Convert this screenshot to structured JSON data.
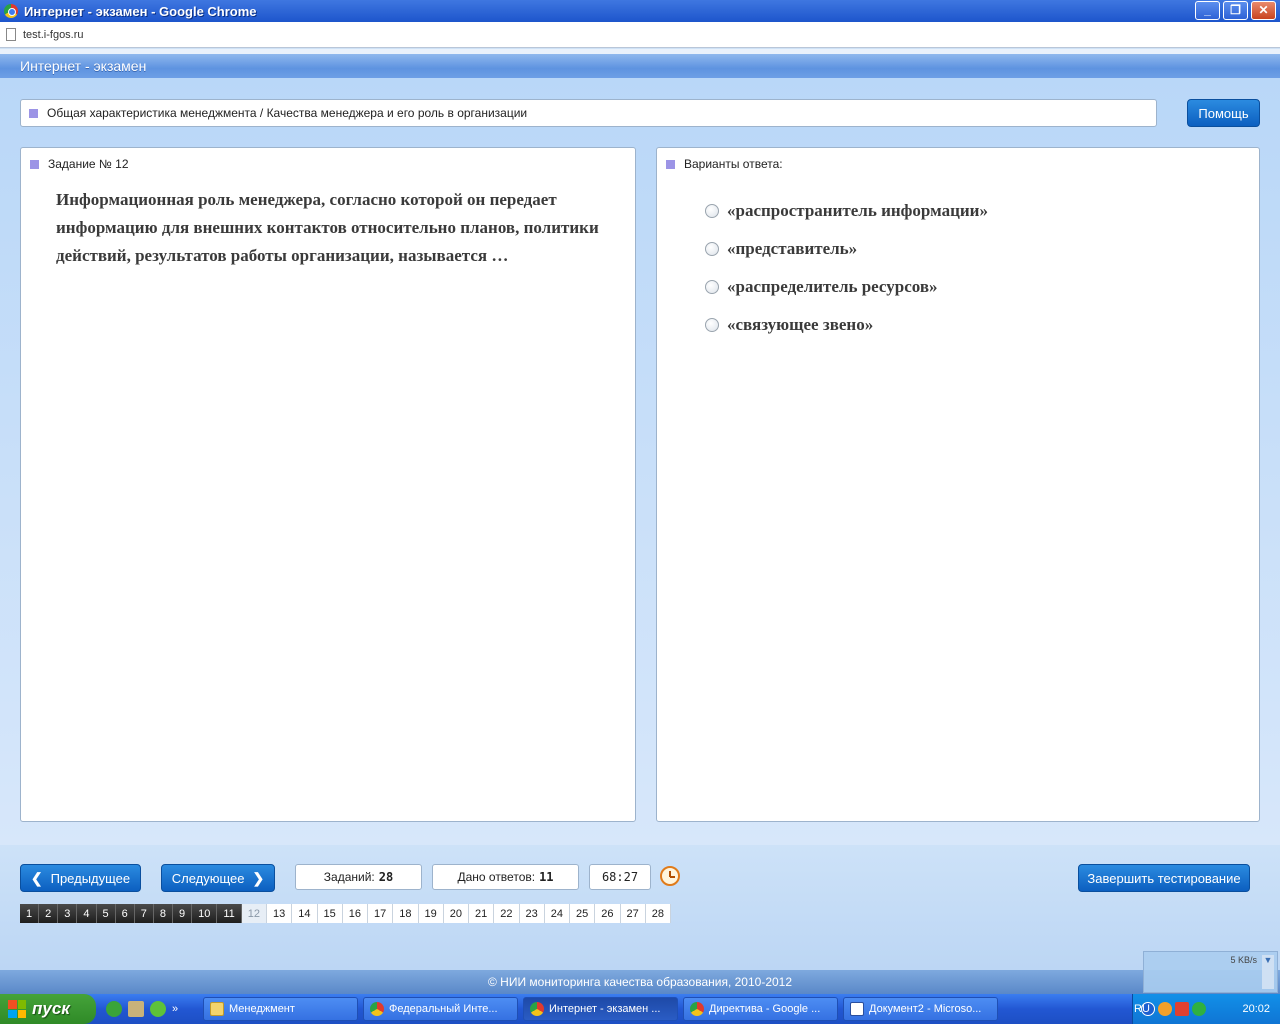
{
  "window": {
    "title": "Интернет - экзамен - Google Chrome",
    "url": "test.i-fgos.ru",
    "buttons": {
      "minimize": "_",
      "restore": "❐",
      "close": "✕"
    }
  },
  "app": {
    "title": "Интернет - экзамен",
    "breadcrumb": "Общая характеристика менеджмента / Качества менеджера и его роль в организации",
    "help_label": "Помощь"
  },
  "task": {
    "heading": "Задание № 12",
    "question": "Информационная роль менеджера, согласно которой он передает информацию для внешних контактов относительно планов, политики действий, результатов работы организации, называется …"
  },
  "answers": {
    "heading": "Варианты ответа:",
    "options": [
      "«распространитель информации»",
      "«представитель»",
      "«распределитель ресурсов»",
      "«связующее звено»"
    ]
  },
  "navigation": {
    "prev_label": "Предыдущее",
    "next_label": "Следующее",
    "tasks_label": "Заданий:",
    "tasks_count": "28",
    "answered_label": "Дано ответов:",
    "answered_count": "11",
    "timer": "68:27",
    "finish_label": "Завершить тестирование",
    "pages_done": [
      "1",
      "2",
      "3",
      "4",
      "5",
      "6",
      "7",
      "8",
      "9",
      "10",
      "11"
    ],
    "page_current": "12",
    "pages_todo": [
      "13",
      "14",
      "15",
      "16",
      "17",
      "18",
      "19",
      "20",
      "21",
      "22",
      "23",
      "24",
      "25",
      "26",
      "27",
      "28"
    ]
  },
  "footer": {
    "copyright": "© НИИ мониторинга качества образования, 2010-2012",
    "speed": "5 KB/s"
  },
  "taskbar": {
    "start_label": "пуск",
    "chevron": "»",
    "tasks": [
      {
        "label": "Менеджмент",
        "icon": "folder-icon",
        "active": false
      },
      {
        "label": "Федеральный Инте...",
        "icon": "chrome-icon",
        "active": false
      },
      {
        "label": "Интернет - экзамен ...",
        "icon": "chrome-icon",
        "active": true
      },
      {
        "label": "Директива - Google ...",
        "icon": "chrome-icon",
        "active": false
      },
      {
        "label": "Документ2 - Microso...",
        "icon": "word-icon",
        "active": false
      }
    ],
    "language": "RU",
    "clock": "20:02"
  },
  "colors": {
    "accent": "#0c5fc0",
    "marker": "#9c94e6",
    "pager_done": "#1e1e1e"
  }
}
